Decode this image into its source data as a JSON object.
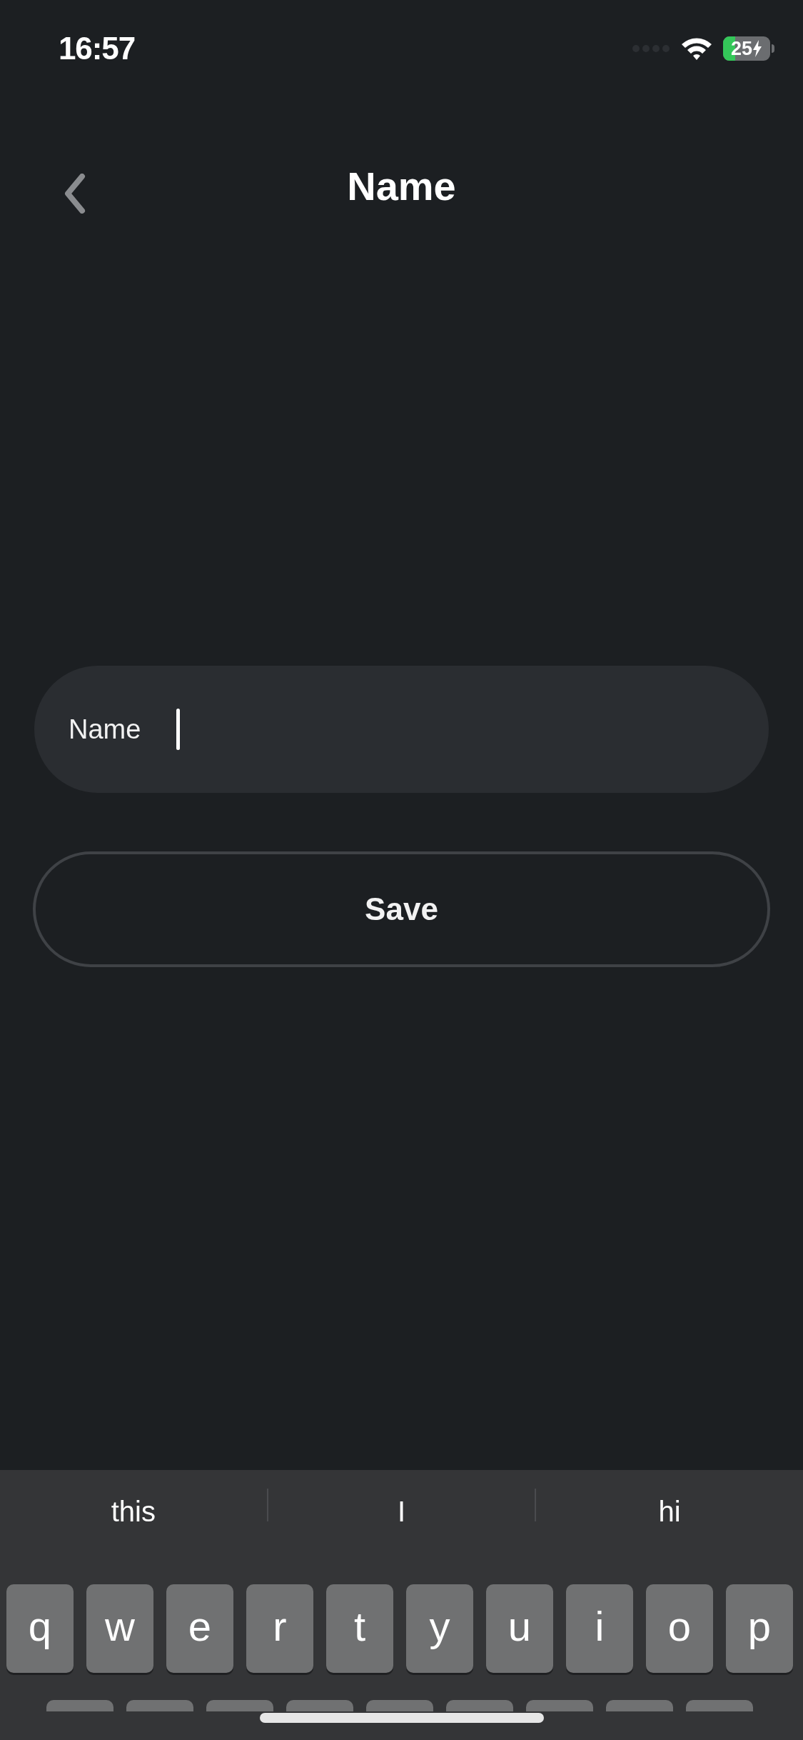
{
  "status_bar": {
    "time": "16:57",
    "battery": {
      "text": "25",
      "level": 0.25,
      "charging": true
    }
  },
  "header": {
    "title": "Name"
  },
  "name_field": {
    "label": "Name",
    "focused": true
  },
  "save_button": {
    "label": "Save"
  },
  "keyboard": {
    "suggestions": [
      "this",
      "I",
      "hi"
    ],
    "rows": [
      [
        "q",
        "w",
        "e",
        "r",
        "t",
        "y",
        "u",
        "i",
        "o",
        "p"
      ]
    ]
  }
}
